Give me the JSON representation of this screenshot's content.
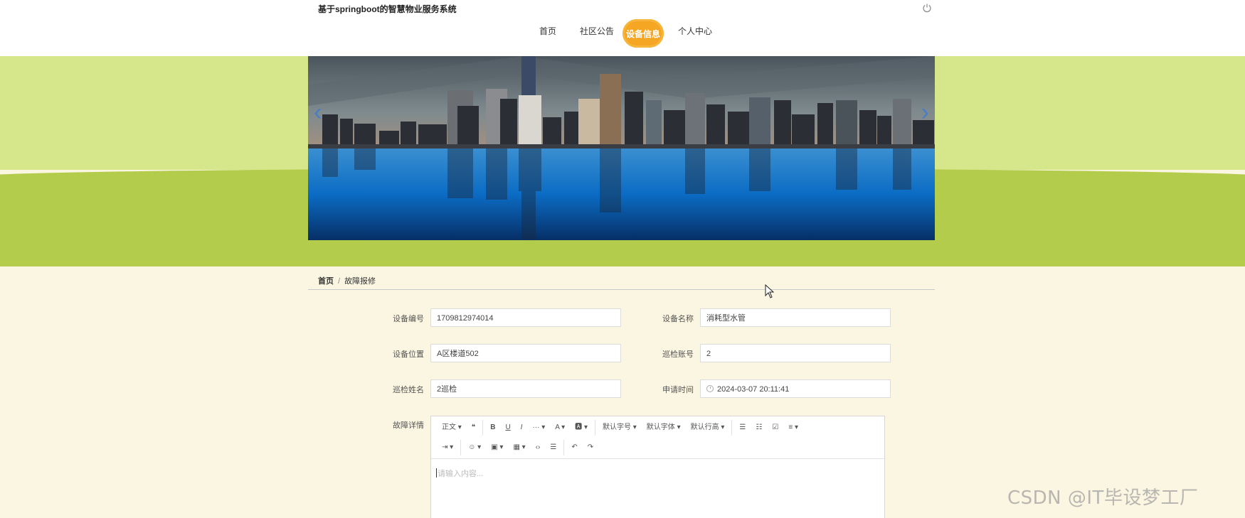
{
  "header": {
    "site_title": "基于springboot的智慧物业服务系统",
    "power_icon": "power-icon"
  },
  "nav": {
    "items": [
      {
        "label": "首页"
      },
      {
        "label": "社区公告"
      },
      {
        "label": "设备信息",
        "active": true
      },
      {
        "label": "个人中心"
      }
    ]
  },
  "banner": {
    "prev_icon": "chevron-left-icon",
    "next_icon": "chevron-right-icon",
    "prev_glyph": "‹",
    "next_glyph": "›"
  },
  "breadcrumb": {
    "home": "首页",
    "separator": "/",
    "current": "故障报修"
  },
  "form": {
    "device_no": {
      "label": "设备编号",
      "value": "1709812974014"
    },
    "device_name": {
      "label": "设备名称",
      "value": "消耗型水管"
    },
    "device_location": {
      "label": "设备位置",
      "value": "A区楼道502"
    },
    "inspect_account": {
      "label": "巡检账号",
      "value": "2"
    },
    "inspect_name": {
      "label": "巡检姓名",
      "value": "2巡检"
    },
    "apply_time": {
      "label": "申请时间",
      "value": "2024-03-07 20:11:41"
    },
    "fault_detail": {
      "label": "故障详情"
    }
  },
  "editor": {
    "toolbar_row1": [
      "正文 ▾",
      "❝",
      "B",
      "U",
      "I",
      "··· ▾",
      "A ▾",
      "🅰 ▾",
      "默认字号 ▾",
      "默认字体 ▾",
      "默认行高 ▾",
      "☰",
      "☷",
      "☑",
      "≡ ▾"
    ],
    "toolbar_row2": [
      "⇥ ▾",
      "☺ ▾",
      "▣ ▾",
      "▦ ▾",
      "‹›",
      "☰",
      "↶",
      "↷"
    ],
    "placeholder": "请输入内容..."
  },
  "watermark": "CSDN @IT毕设梦工厂",
  "colors": {
    "accent": "#f5a623",
    "band_light": "#d6e68a",
    "band_dark": "#b4cc4c",
    "page_bg": "#fbf6e1"
  }
}
